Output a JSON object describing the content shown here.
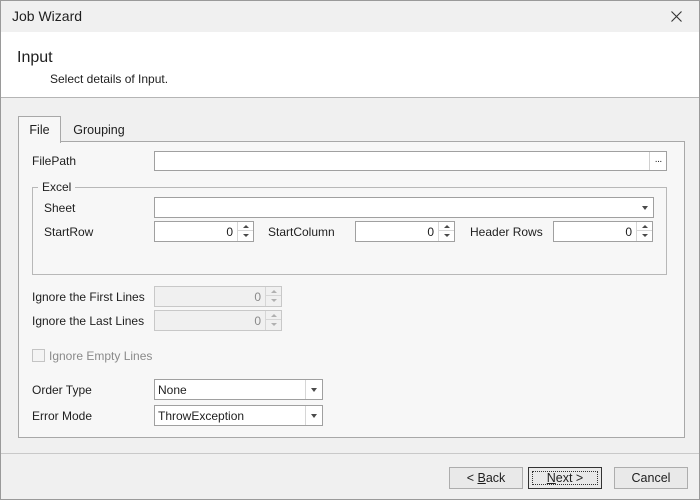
{
  "window": {
    "title": "Job Wizard"
  },
  "header": {
    "title": "Input",
    "subtitle": "Select details of Input."
  },
  "tabs": [
    {
      "label": "File",
      "active": true
    },
    {
      "label": "Grouping",
      "active": false
    }
  ],
  "file": {
    "filepath_label": "FilePath",
    "filepath_value": "",
    "browse_label": "···",
    "excel": {
      "legend": "Excel",
      "sheet_label": "Sheet",
      "sheet_value": "",
      "startrow_label": "StartRow",
      "startrow_value": "0",
      "startcolumn_label": "StartColumn",
      "startcolumn_value": "0",
      "headerrows_label": "Header Rows",
      "headerrows_value": "0"
    },
    "ignore_first_label": "Ignore the First Lines",
    "ignore_first_value": "0",
    "ignore_last_label": "Ignore the Last Lines",
    "ignore_last_value": "0",
    "ignore_empty_label": "Ignore Empty Lines",
    "ignore_empty_checked": false,
    "order_type_label": "Order Type",
    "order_type_value": "None",
    "error_mode_label": "Error Mode",
    "error_mode_value": "ThrowException"
  },
  "footer": {
    "back_prefix": "< ",
    "back_mnemonic": "B",
    "back_rest": "ack",
    "next_mnemonic": "N",
    "next_rest": "ext >",
    "cancel_label": "Cancel"
  },
  "colors": {
    "header_bg": "#ffffff",
    "window_bg": "#f0f0f0",
    "panel_bg": "#f7f7f7",
    "disabled_text": "#8a8a8a"
  }
}
